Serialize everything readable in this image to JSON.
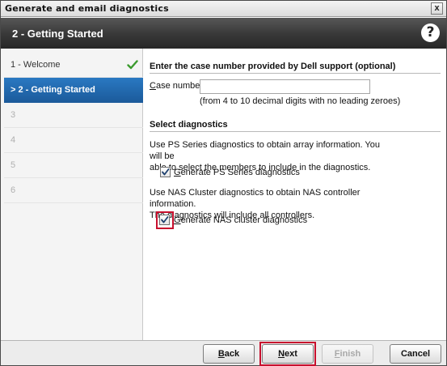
{
  "window": {
    "title": "Generate and email diagnostics",
    "close_glyph": "x"
  },
  "header": {
    "step_title": "2 - Getting Started",
    "help_glyph": "?"
  },
  "sidebar": {
    "items": [
      {
        "label": "1 - Welcome",
        "state": "done"
      },
      {
        "label": ">  2 - Getting Started",
        "state": "active"
      },
      {
        "label": "3",
        "state": "disabled"
      },
      {
        "label": "4",
        "state": "disabled"
      },
      {
        "label": "5",
        "state": "disabled"
      },
      {
        "label": "6",
        "state": "disabled"
      }
    ]
  },
  "case_section": {
    "title": "Enter the case number provided by Dell support (optional)",
    "case_label_prefix": "C",
    "case_label_rest": "ase number:",
    "case_value": "",
    "hint": "(from 4 to 10 decimal digits with no leading zeroes)"
  },
  "diagnostics_section": {
    "title": "Select diagnostics",
    "ps_desc_line1": "Use PS Series diagnostics to obtain array information. You will be",
    "ps_desc_line2": "able to select the members to include in the diagnostics.",
    "ps_checkbox_label_prefix": "G",
    "ps_checkbox_label_rest": "enerate PS Series diagnostics",
    "ps_checked": true,
    "nas_desc_line1": "Use NAS Cluster diagnostics to obtain NAS controller information.",
    "nas_desc_line2": "The diagnostics will include all controllers.",
    "nas_checkbox_label_prefix": "G",
    "nas_checkbox_label_rest": "enerate NAS cluster diagnostics",
    "nas_checked": true
  },
  "footer": {
    "back_prefix": "B",
    "back_rest": "ack",
    "next_prefix": "N",
    "next_rest": "ext",
    "finish_prefix": "F",
    "finish_rest": "inish",
    "cancel_label": "Cancel"
  },
  "colors": {
    "accent": "#1b5a9a",
    "highlight": "#c8102e",
    "check": "#3b9a2e"
  }
}
